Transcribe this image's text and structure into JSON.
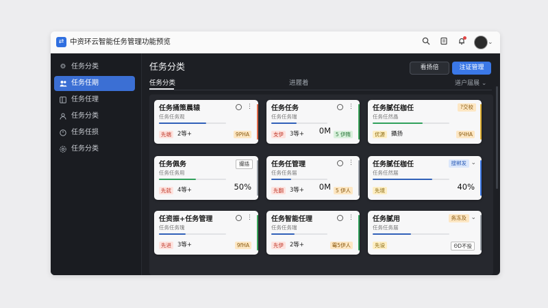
{
  "window": {
    "title": "中资环云智能任务管理功能预览"
  },
  "titlebar_icons": [
    "search-icon",
    "document-icon",
    "bell-icon"
  ],
  "sidebar": {
    "items": [
      {
        "label": "任务分类",
        "icon": "gear-icon"
      },
      {
        "label": "任务任期",
        "icon": "users-icon",
        "active": true
      },
      {
        "label": "任务任理",
        "icon": "board-icon"
      },
      {
        "label": "任务分类",
        "icon": "user-icon"
      },
      {
        "label": "任务任损",
        "icon": "clock-icon"
      },
      {
        "label": "任务分类",
        "icon": "settings-icon"
      }
    ]
  },
  "main": {
    "title": "任务分类",
    "buttons": {
      "secondary": "看扬倍",
      "primary": "注证管理"
    },
    "tabs": [
      {
        "label": "任务分类",
        "active": true
      },
      {
        "label": "进履着"
      }
    ],
    "view_select": "道户届展"
  },
  "cards": [
    {
      "title": "任务捅策晨辕",
      "subtitle": "任务任务观",
      "stripe": "#e06a4a",
      "progress": 0.7,
      "prog_color": "#2f5fb8",
      "tag": "先端",
      "tag_bg": "#fde2de",
      "tag_fg": "#c0392b",
      "count": "2等+",
      "chip": "9PHA",
      "chip_bg": "#fde7c4",
      "chip_fg": "#8a5a10"
    },
    {
      "title": "任务任务",
      "subtitle": "任务任务瑞",
      "stripe": "#3aa55a",
      "progress": 0.45,
      "prog_color": "#2f5fb8",
      "tag": "支伊",
      "tag_bg": "#fde2de",
      "tag_fg": "#c0392b",
      "count": "3等+",
      "num": "0M",
      "chip": "5 伊隋",
      "chip_bg": "#d9f0dc",
      "chip_fg": "#2d7a3e"
    },
    {
      "title": "任务腻任枷任",
      "subtitle": "任务任然晶",
      "stripe": "#e0b030",
      "badge": "?交校",
      "badge_bg": "#fde7c4",
      "badge_fg": "#8a5a10",
      "progress": 0.65,
      "prog_color": "#2fa05a",
      "tag": "优源",
      "tag_bg": "#fdeec4",
      "tag_fg": "#8a6a10",
      "count": "攝扬",
      "chip": "9ЧHA",
      "chip_bg": "#fde7c4",
      "chip_fg": "#8a5a10"
    },
    {
      "title": "任务佩务",
      "subtitle": "任务任务用",
      "stripe": "#9aa0a8",
      "badge": "撮插",
      "badge_bg": "#ffffff",
      "badge_fg": "#333333",
      "badge_border": true,
      "progress": 0.55,
      "prog_color": "#2fa05a",
      "tag": "先就",
      "tag_bg": "#fde2de",
      "tag_fg": "#c0392b",
      "count": "4等+",
      "num": "50%"
    },
    {
      "title": "任务任管理",
      "subtitle": "任务任务届",
      "stripe": "#9aa0a8",
      "progress": 0.35,
      "prog_color": "#2f5fb8",
      "tag": "先翻",
      "tag_bg": "#fde2de",
      "tag_fg": "#c0392b",
      "count": "3等+",
      "num": "0M",
      "chip": "5 伊人",
      "chip_bg": "#fde7c4",
      "chip_fg": "#8a5a10"
    },
    {
      "title": "任务腻任枷任",
      "subtitle": "任务任然届",
      "stripe": "#3b78e7",
      "badge": "搜郴发",
      "badge_bg": "#dbe7fb",
      "badge_fg": "#2f5fb8",
      "has_chevron": true,
      "progress": 0.78,
      "prog_color": "#2f5fb8",
      "tag": "先境",
      "tag_bg": "#fdeec4",
      "tag_fg": "#8a6a10",
      "num": "40%"
    },
    {
      "title": "任资振+任务管理",
      "subtitle": "任务任务瑰",
      "stripe": "#3aa55a",
      "progress": 0.4,
      "prog_color": "#2f5fb8",
      "tag": "先进",
      "tag_bg": "#fde2de",
      "tag_fg": "#c0392b",
      "count": "3等+",
      "chip": "9fHA",
      "chip_bg": "#fde7c4",
      "chip_fg": "#8a5a10"
    },
    {
      "title": "任务智能任理",
      "subtitle": "任务任务瑞",
      "stripe": "#2fa05a",
      "progress": 0.42,
      "prog_color": "#2f5fb8",
      "tag": "先伊",
      "tag_bg": "#fde2de",
      "tag_fg": "#c0392b",
      "count": "2等+",
      "chip": "霉5伊人",
      "chip_bg": "#fde7c4",
      "chip_fg": "#8a5a10"
    },
    {
      "title": "任务腻用",
      "subtitle": "任务任务届",
      "stripe": "#9aa0a8",
      "badge": "务冻及",
      "badge_bg": "#fde7c4",
      "badge_fg": "#8a5a10",
      "has_chevron": true,
      "progress": 0.5,
      "prog_color": "#2f5fb8",
      "tag": "先设",
      "tag_bg": "#fdeec4",
      "tag_fg": "#8a6a10",
      "chip": "ΘD不投",
      "chip_bg": "#ffffff",
      "chip_fg": "#333333",
      "chip_border": true
    }
  ]
}
